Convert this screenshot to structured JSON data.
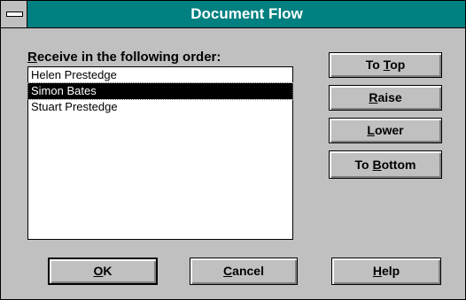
{
  "window": {
    "title": "Document Flow"
  },
  "list": {
    "label_prefix": "R",
    "label_rest": "eceive in the following order:",
    "items": [
      {
        "label": "Helen Prestedge",
        "selected": false
      },
      {
        "label": "Simon Bates",
        "selected": true
      },
      {
        "label": "Stuart Prestedge",
        "selected": false
      }
    ]
  },
  "buttons": {
    "to_top": {
      "pre": "To ",
      "accel": "T",
      "post": "op"
    },
    "raise": {
      "pre": "",
      "accel": "R",
      "post": "aise"
    },
    "lower": {
      "pre": "",
      "accel": "L",
      "post": "ower"
    },
    "to_bottom": {
      "pre": "To ",
      "accel": "B",
      "post": "ottom"
    },
    "ok": {
      "pre": "",
      "accel": "O",
      "post": "K"
    },
    "cancel": {
      "pre": "",
      "accel": "C",
      "post": "ancel"
    },
    "help": {
      "pre": "",
      "accel": "H",
      "post": "elp"
    }
  }
}
